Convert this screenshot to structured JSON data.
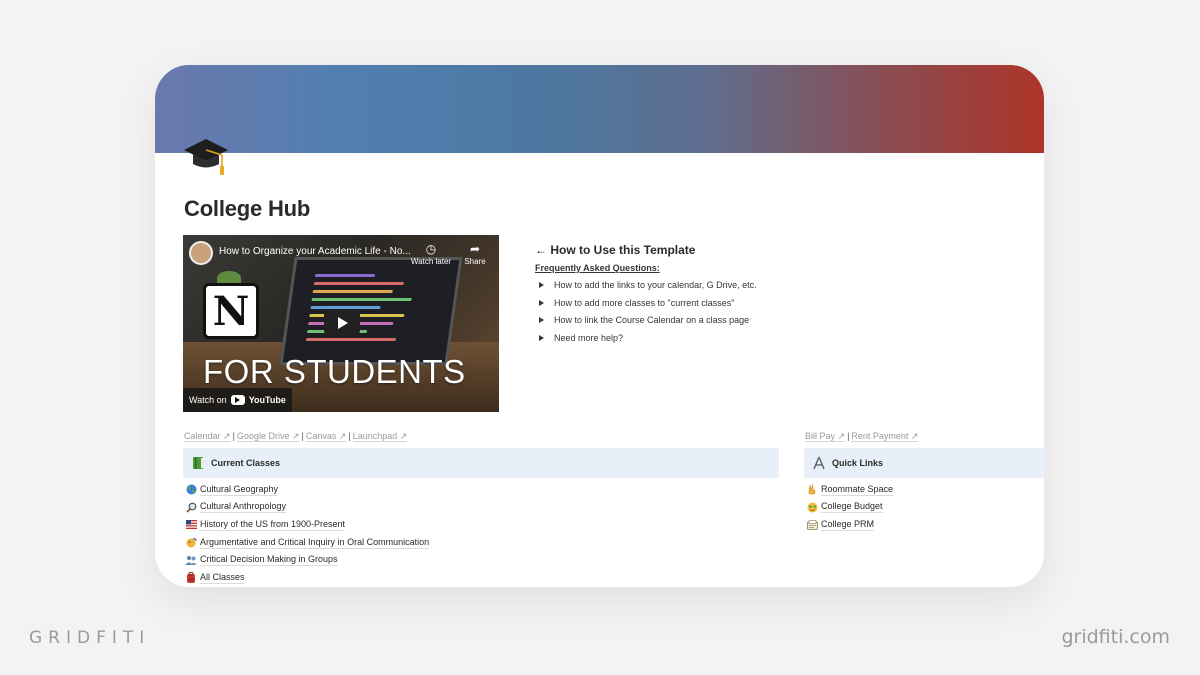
{
  "page": {
    "title": "College Hub",
    "icon": "graduation-cap-icon"
  },
  "video": {
    "title": "How to Organize your Academic Life - No...",
    "watch_later": "Watch later",
    "share": "Share",
    "overlay_text": "FOR STUDENTS",
    "logo_letter": "N",
    "watch_on": "Watch on",
    "youtube": "YouTube"
  },
  "howto": {
    "heading": "← How to Use this Template",
    "faq_label": "Frequently Asked Questions:",
    "items": [
      "How to add the links to your calendar, G Drive, etc.",
      "How to add more classes to \"current classes\"",
      "How to link the Course Calendar on a class page",
      "Need more help?"
    ]
  },
  "left_links": {
    "items": [
      "Calendar ↗",
      "Google Drive ↗",
      "Canvas ↗",
      "Launchpad ↗"
    ],
    "separator": "|"
  },
  "right_links": {
    "items": [
      "Bill Pay ↗",
      "Rent Payment ↗"
    ],
    "separator": "|"
  },
  "current_classes": {
    "heading": "Current Classes",
    "icon": "green-book-icon",
    "items": [
      {
        "label": "Cultural Geography",
        "icon": "globe-icon"
      },
      {
        "label": "Cultural Anthropology",
        "icon": "magnifier-icon"
      },
      {
        "label": "History of the US from 1900-Present",
        "icon": "us-flag-icon"
      },
      {
        "label": "Argumentative and Critical Inquiry in Oral Communication",
        "icon": "speaking-face-icon"
      },
      {
        "label": "Critical Decision Making in Groups",
        "icon": "people-icon"
      },
      {
        "label": "All Classes",
        "icon": "backpack-icon"
      }
    ]
  },
  "quick_links": {
    "heading": "Quick Links",
    "icon": "compass-icon",
    "items": [
      {
        "label": "Roommate Space",
        "icon": "victory-hand-icon"
      },
      {
        "label": "College Budget",
        "icon": "money-face-icon"
      },
      {
        "label": "College PRM",
        "icon": "card-index-icon"
      }
    ]
  },
  "watermark": {
    "left": "GRIDFITI",
    "right": "gridfiti.com"
  },
  "colors": {
    "callout_bg": "#e7f0f8",
    "cover_start": "#6b79ad",
    "cover_end": "#ad3428"
  }
}
